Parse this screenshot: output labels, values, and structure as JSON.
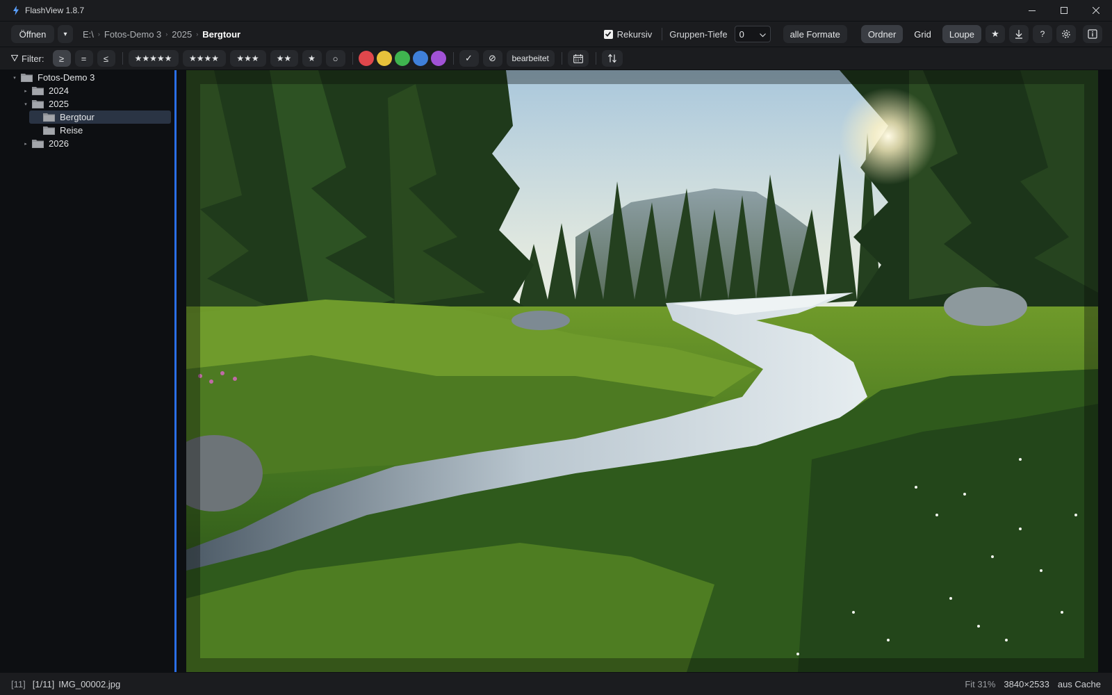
{
  "window": {
    "title": "FlashView 1.8.7",
    "icons": {
      "app": "lightning-icon",
      "minimize": "minimize-icon",
      "maximize": "maximize-icon",
      "close": "close-icon"
    }
  },
  "toolbar": {
    "open_label": "Öffnen",
    "open_menu_glyph": "▾",
    "breadcrumb": [
      "E:\\",
      "Fotos-Demo 3",
      "2025",
      "Bergtour"
    ],
    "recursive_label": "Rekursiv",
    "recursive_checked": true,
    "group_depth_label": "Gruppen-Tiefe",
    "group_depth_value": "0",
    "formats_label": "alle Formate",
    "view_modes": [
      "Ordner",
      "Grid",
      "Loupe"
    ],
    "active_view_mode": "Loupe",
    "icon_buttons": [
      "star-icon",
      "download-icon",
      "help-icon",
      "gear-icon",
      "info-panel-icon"
    ],
    "star_glyph": "★",
    "help_glyph": "?"
  },
  "filter": {
    "label": "Filter:",
    "comparators": [
      "≥",
      "=",
      "≤"
    ],
    "active_comparator": "≥",
    "ratings": [
      "★★★★★",
      "★★★★",
      "★★★",
      "★★",
      "★",
      "○"
    ],
    "color_labels": [
      "#e0474c",
      "#e7c23b",
      "#3fb34f",
      "#3f7fd9",
      "#a152d6"
    ],
    "check_glyph": "✓",
    "reject_glyph": "⊘",
    "edited_label": "bearbeitet",
    "icons": [
      "calendar-icon",
      "sort-icon"
    ]
  },
  "tree": {
    "items": [
      {
        "label": "Fotos-Demo 3",
        "depth": 0,
        "caret": "▾",
        "selected": false
      },
      {
        "label": "2024",
        "depth": 1,
        "caret": "▸",
        "selected": false
      },
      {
        "label": "2025",
        "depth": 1,
        "caret": "▾",
        "selected": false
      },
      {
        "label": "Bergtour",
        "depth": 2,
        "caret": "",
        "selected": true
      },
      {
        "label": "Reise",
        "depth": 2,
        "caret": "",
        "selected": false
      },
      {
        "label": "2026",
        "depth": 1,
        "caret": "▸",
        "selected": false
      }
    ]
  },
  "viewer": {
    "image_subject": "mountain-stream-forest-photo"
  },
  "status": {
    "count": "[11]",
    "position": "[1/11]",
    "filename": "IMG_00002.jpg",
    "zoom": "Fit 31%",
    "dimensions": "3840×2533",
    "source": "aus Cache"
  },
  "colors": {
    "accent": "#2a6ee6",
    "selection": "#2a3444",
    "chrome": "#1b1c1f",
    "background": "#0d0f12"
  }
}
